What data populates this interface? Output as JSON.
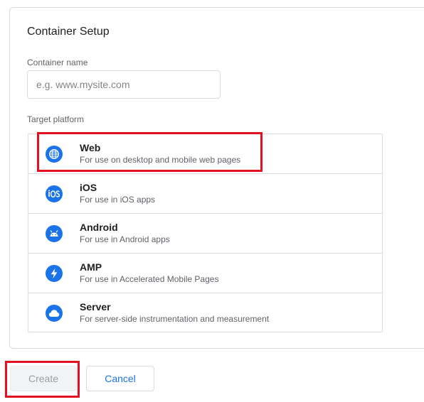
{
  "setup": {
    "title": "Container Setup",
    "name_label": "Container name",
    "name_value": "",
    "name_placeholder": "e.g. www.mysite.com",
    "platform_label": "Target platform"
  },
  "platforms": [
    {
      "name": "Web",
      "desc": "For use on desktop and mobile web pages",
      "icon": "globe-icon"
    },
    {
      "name": "iOS",
      "desc": "For use in iOS apps",
      "icon": "ios-icon"
    },
    {
      "name": "Android",
      "desc": "For use in Android apps",
      "icon": "android-icon"
    },
    {
      "name": "AMP",
      "desc": "For use in Accelerated Mobile Pages",
      "icon": "lightning-icon"
    },
    {
      "name": "Server",
      "desc": "For server-side instrumentation and measurement",
      "icon": "cloud-icon"
    }
  ],
  "actions": {
    "create_label": "Create",
    "cancel_label": "Cancel"
  },
  "colors": {
    "accent": "#1a73e8",
    "highlight": "#e3101f",
    "border": "#dadce0"
  }
}
